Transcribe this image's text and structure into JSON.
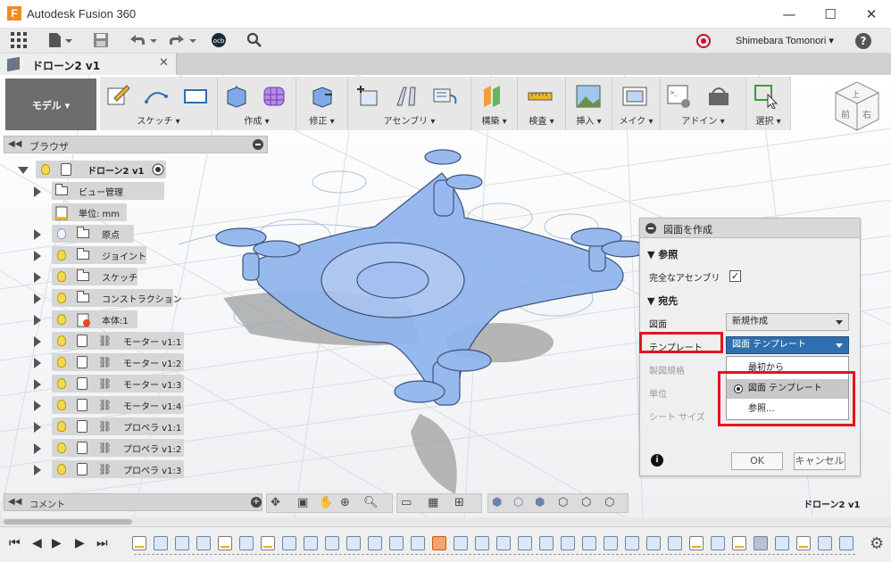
{
  "window": {
    "app_title": "Autodesk Fusion 360",
    "controls": [
      "—",
      "☐",
      "✕"
    ]
  },
  "qat": {
    "user_name": "Shimebara Tomonori ▾",
    "help": "?"
  },
  "document_tab": {
    "title": "ドローン2 v1",
    "close": "✕"
  },
  "toolbar": {
    "mode_label": "モデル ▾",
    "groups": [
      {
        "label": "スケッチ ▾"
      },
      {
        "label": "作成 ▾"
      },
      {
        "label": "修正 ▾"
      },
      {
        "label": "アセンブリ ▾"
      },
      {
        "label": "構築 ▾"
      },
      {
        "label": "検査 ▾"
      },
      {
        "label": "挿入 ▾"
      },
      {
        "label": "メイク ▾"
      },
      {
        "label": "アドイン ▾"
      },
      {
        "label": "選択 ▾"
      }
    ]
  },
  "viewcube": {
    "front": "前",
    "right": "右",
    "top": "上"
  },
  "browser": {
    "title": "ブラウザ",
    "root": "ドローン2 v1",
    "items": [
      {
        "label": "ビュー管理"
      },
      {
        "label": "単位: mm"
      },
      {
        "label": "原点"
      },
      {
        "label": "ジョイント"
      },
      {
        "label": "スケッチ"
      },
      {
        "label": "コンストラクション"
      },
      {
        "label": "本体:1"
      },
      {
        "label": "モーター v1:1"
      },
      {
        "label": "モーター v1:2"
      },
      {
        "label": "モーター v1:3"
      },
      {
        "label": "モーター v1:4"
      },
      {
        "label": "プロペラ v1:1"
      },
      {
        "label": "プロペラ v1:2"
      },
      {
        "label": "プロペラ v1:3"
      }
    ]
  },
  "dialog": {
    "title": "図面を作成",
    "section_reference": "参照",
    "full_assembly_label": "完全なアセンブリ",
    "full_assembly_checked": true,
    "section_destination": "宛先",
    "drawing_label": "図面",
    "drawing_value": "新規作成",
    "template_label": "テンプレート",
    "template_value": "図面 テンプレート",
    "standard_label": "製図規格",
    "units_label": "単位",
    "sheet_size_label": "シート サイズ",
    "dropdown_options": [
      "最初から",
      "図面 テンプレート",
      "参照..."
    ],
    "ok_label": "OK",
    "cancel_label": "キャンセル",
    "info": "i"
  },
  "bottom": {
    "comments_title": "コメント",
    "document_name": "ドローン2 v1"
  },
  "colors": {
    "highlight_red": "#e3141c",
    "model_blue": "#8fb4ee",
    "active_select": "#2f6fb0"
  }
}
